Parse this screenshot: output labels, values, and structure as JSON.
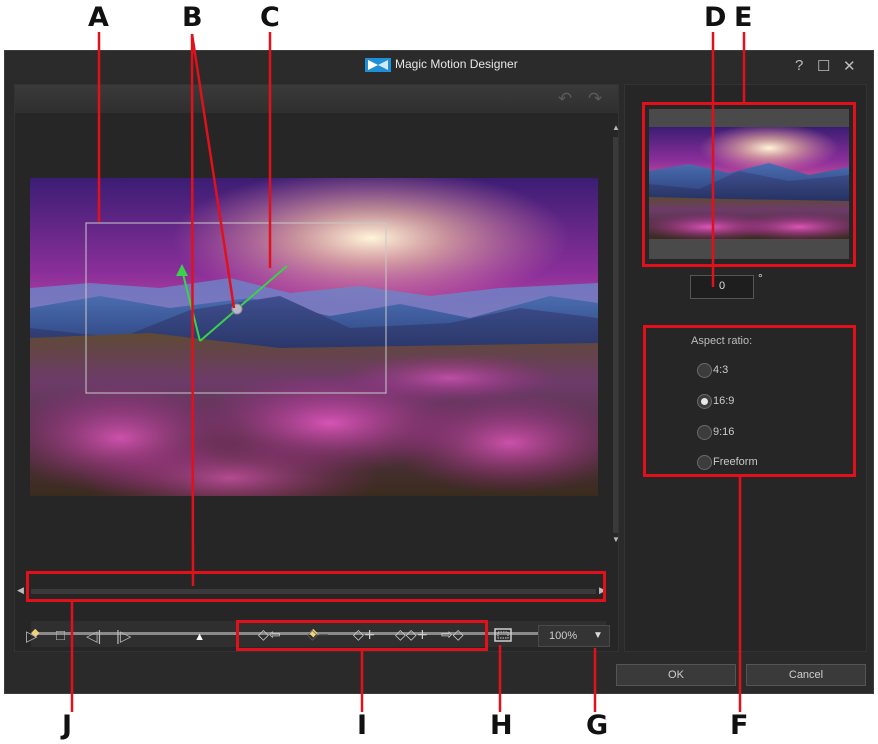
{
  "window": {
    "title": "Magic Motion Designer",
    "help_icon": "question-icon",
    "maximize_icon": "maximize-icon",
    "close_icon": "close-icon"
  },
  "callouts": [
    "A",
    "B",
    "C",
    "D",
    "E",
    "F",
    "G",
    "H",
    "I",
    "J"
  ],
  "toolbar": {
    "undo_icon": "undo-icon",
    "redo_icon": "redo-icon"
  },
  "canvas": {
    "image": "mountain sunset with pink flowers"
  },
  "rotation": {
    "value": "0",
    "unit": "°"
  },
  "aspect_ratio": {
    "label": "Aspect ratio:",
    "options": [
      "4:3",
      "16:9",
      "9:16",
      "Freeform"
    ],
    "selected": "16:9"
  },
  "timeline": {
    "keyframe_color": "#f2d27a",
    "playhead_position": 0.29
  },
  "playback": {
    "play_icon": "play-icon",
    "stop_icon": "stop-icon",
    "prev_frame_icon": "prev-frame-icon",
    "next_frame_icon": "next-frame-icon"
  },
  "keyframe_buttons": {
    "prev": "◇⇦",
    "remove": "◇−",
    "add": "◇+",
    "duplicate": "◇◇+",
    "next": "⇨◇"
  },
  "zoom": {
    "value": "100%"
  },
  "buttons": {
    "ok": "OK",
    "cancel": "Cancel"
  },
  "colors": {
    "highlight": "#e1111b",
    "motion_path": "#3bd14a",
    "window_bg": "#2a2a2a"
  }
}
